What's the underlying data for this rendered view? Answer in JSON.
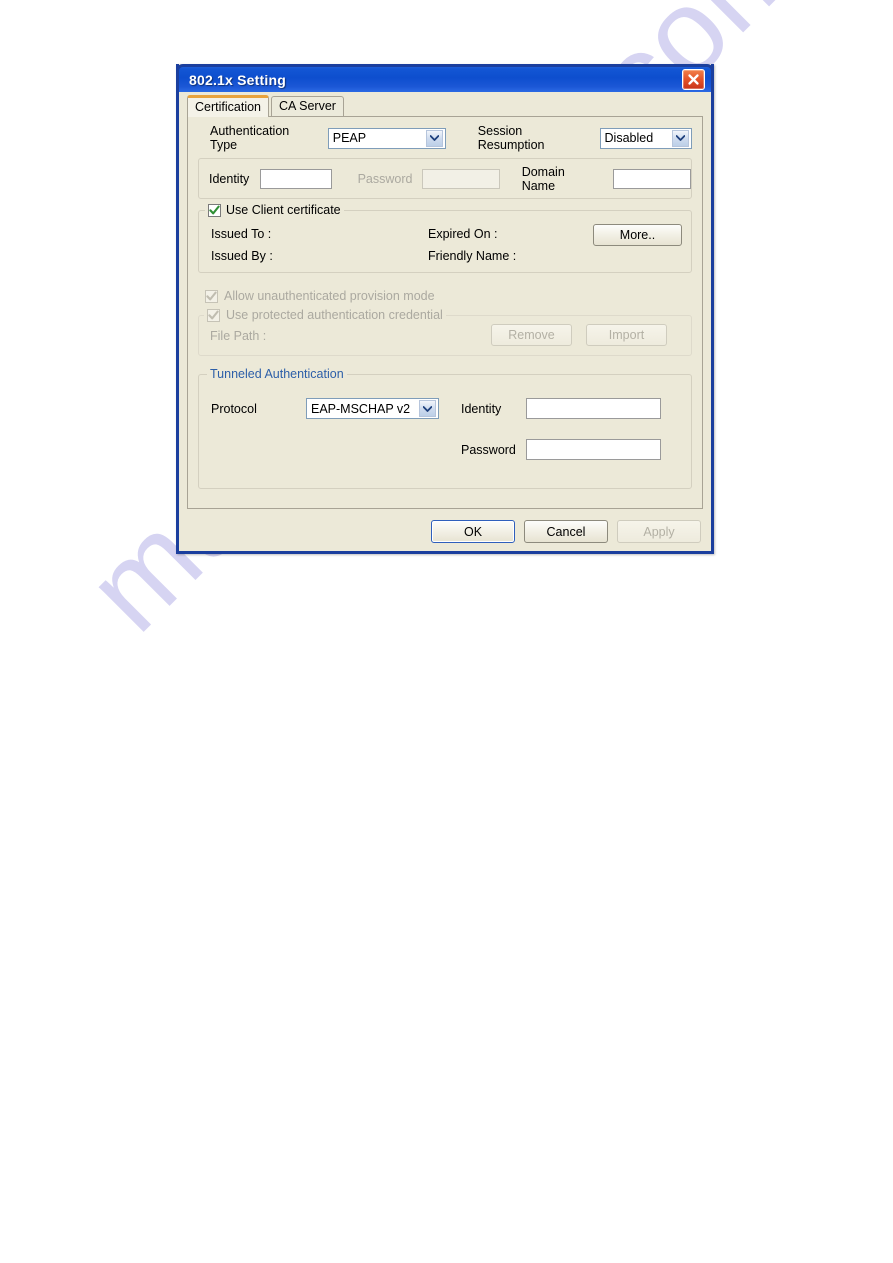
{
  "watermark": {
    "text": "manualshive.com"
  },
  "dialog": {
    "title": "802.1x Setting",
    "close_icon": "close-icon",
    "tabs": [
      {
        "label": "Certification",
        "active": true
      },
      {
        "label": "CA Server",
        "active": false
      }
    ],
    "auth": {
      "type_label": "Authentication Type",
      "type_value": "PEAP",
      "session_label": "Session Resumption",
      "session_value": "Disabled"
    },
    "credentials": {
      "identity_label": "Identity",
      "identity_value": "",
      "password_label": "Password",
      "password_value": "",
      "password_disabled": true,
      "domain_label": "Domain Name",
      "domain_value": ""
    },
    "client_certificate": {
      "checkbox_label": "Use Client certificate",
      "checked": true,
      "issued_to_label": "Issued To :",
      "issued_to_value": "",
      "issued_by_label": "Issued By :",
      "issued_by_value": "",
      "expired_on_label": "Expired On :",
      "expired_on_value": "",
      "friendly_name_label": "Friendly Name :",
      "friendly_name_value": "",
      "more_button": "More.."
    },
    "provision": {
      "allow_label": "Allow unauthenticated provision mode",
      "allow_checked": true,
      "allow_disabled": true,
      "pac_label": "Use protected authentication credential",
      "pac_checked": true,
      "pac_disabled": true,
      "file_path_label": "File Path :",
      "file_path_value": "",
      "remove_button": "Remove",
      "import_button": "Import",
      "buttons_disabled": true
    },
    "tunneled": {
      "legend": "Tunneled Authentication",
      "protocol_label": "Protocol",
      "protocol_value": "EAP-MSCHAP v2",
      "identity_label": "Identity",
      "identity_value": "",
      "password_label": "Password",
      "password_value": ""
    },
    "footer": {
      "ok": "OK",
      "cancel": "Cancel",
      "apply": "Apply",
      "apply_disabled": true
    }
  },
  "colors": {
    "titlebar": "#0d4ece",
    "window_border": "#1b3f9e",
    "face": "#ece9d8",
    "active_tab_accent": "#e8a33d",
    "legend_blue": "#2d5fa8",
    "close_red": "#e4542a",
    "check_green": "#2f8f34",
    "watermark": "#c9c6ee"
  }
}
